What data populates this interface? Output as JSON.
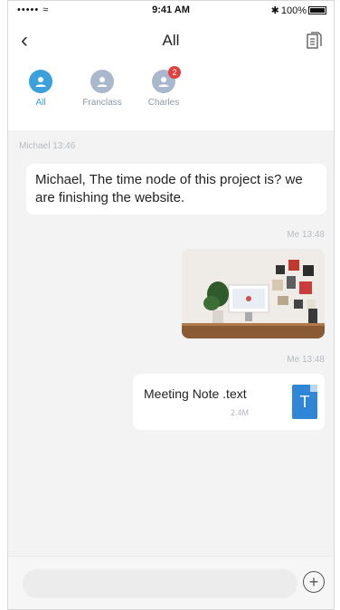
{
  "status_bar": {
    "signal": "••••• ≈",
    "time": "9:41 AM",
    "battery": "100%"
  },
  "nav": {
    "back_icon": "chevron-left-icon",
    "title": "All",
    "doc_icon": "document-icon"
  },
  "members": [
    {
      "name": "All",
      "active": true,
      "badge": ""
    },
    {
      "name": "Franclass",
      "active": false,
      "badge": ""
    },
    {
      "name": "Charles",
      "active": false,
      "badge": "2"
    }
  ],
  "messages": {
    "incoming": {
      "sender": "Michael",
      "time": "13:46",
      "text": "Michael, The time node of  this project is? we are finishing the website."
    },
    "photo": {
      "sender": "Me",
      "time": "13:48"
    },
    "file": {
      "sender": "Me",
      "time": "13:48",
      "name": "Meeting Note .text",
      "size": "2.4M",
      "icon_letter": "T"
    }
  },
  "input": {
    "placeholder": "",
    "add_icon": "plus-circle-icon"
  },
  "colors": {
    "accent": "#3aa1dd",
    "badge": "#e2403a",
    "file_icon": "#2f86d6",
    "chat_bg": "#f3f3f3"
  }
}
